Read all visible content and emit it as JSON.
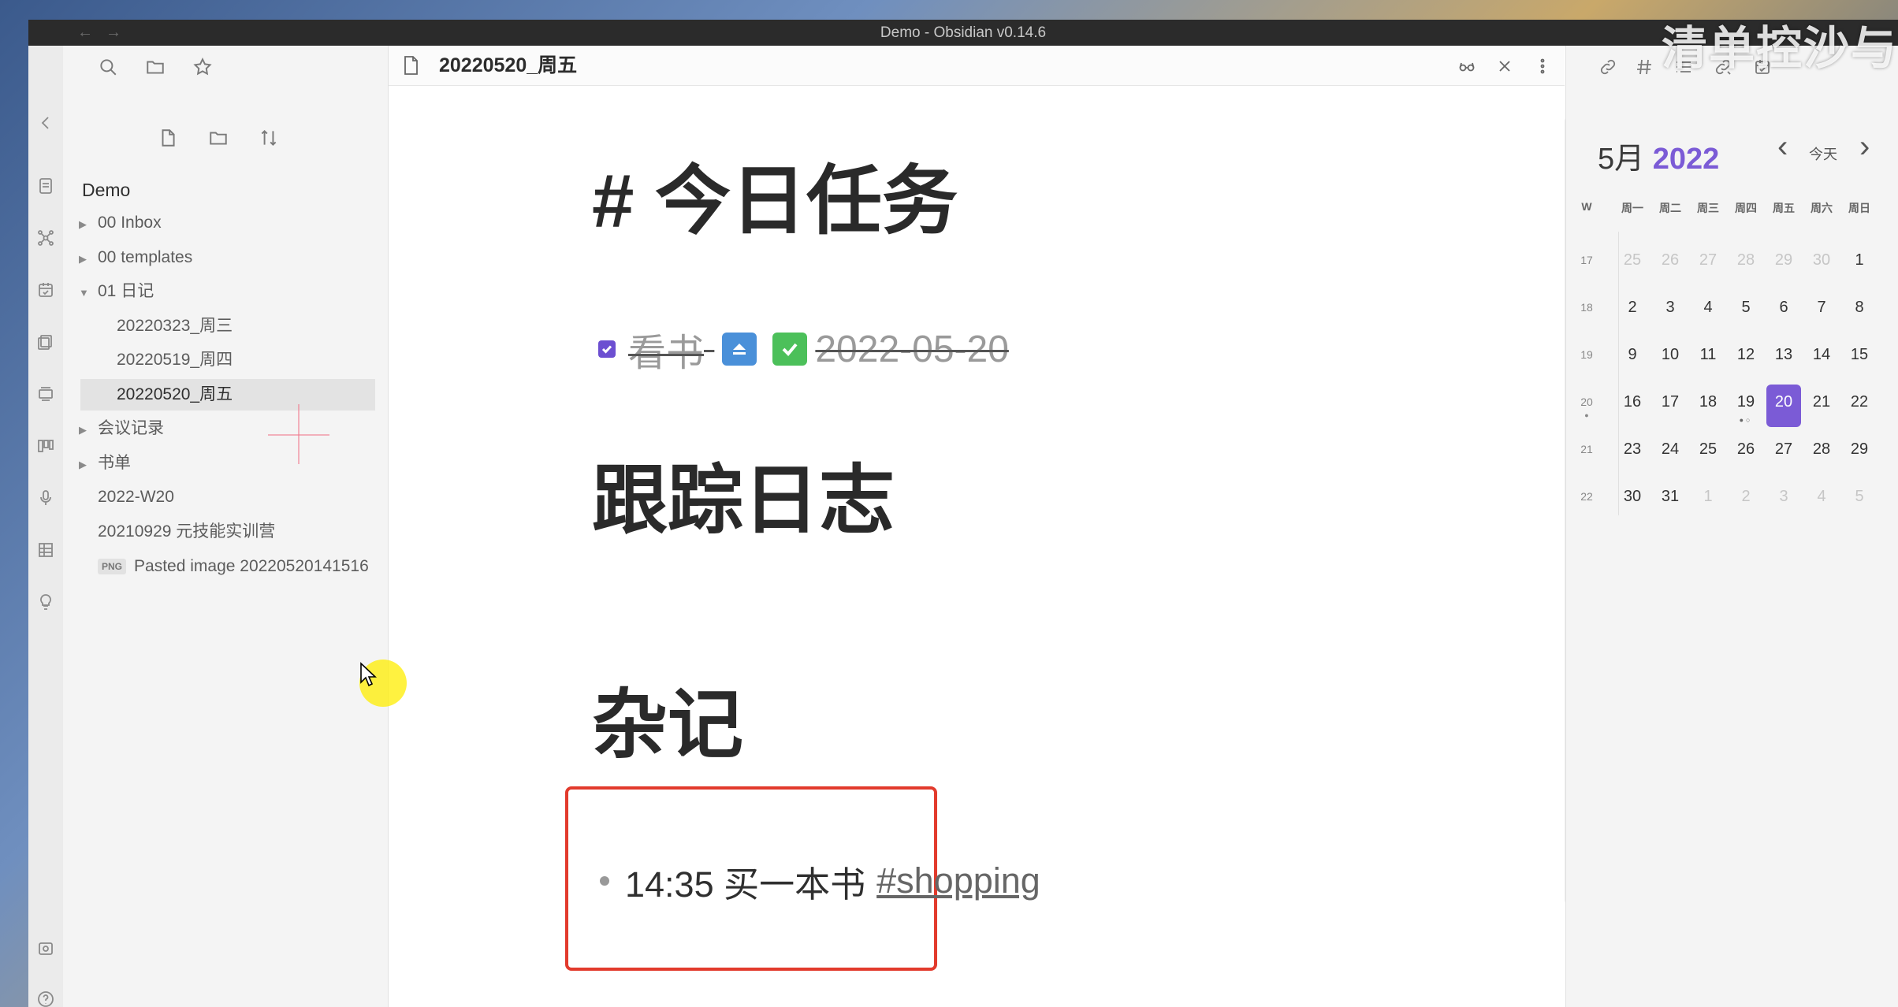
{
  "window": {
    "title": "Demo - Obsidian v0.14.6",
    "back": "←",
    "forward": "→"
  },
  "watermark": "清单控沙与",
  "sidebar": {
    "vault_name": "Demo",
    "tree": [
      {
        "label": "00 Inbox",
        "kind": "folder",
        "expanded": false
      },
      {
        "label": "00 templates",
        "kind": "folder",
        "expanded": false
      },
      {
        "label": "01 日记",
        "kind": "folder",
        "expanded": true
      },
      {
        "label": "20220323_周三",
        "kind": "file"
      },
      {
        "label": "20220519_周四",
        "kind": "file"
      },
      {
        "label": "20220520_周五",
        "kind": "file",
        "active": true
      },
      {
        "label": "会议记录",
        "kind": "folder",
        "expanded": false
      },
      {
        "label": "书单",
        "kind": "folder",
        "expanded": false
      },
      {
        "label": "2022-W20",
        "kind": "file"
      },
      {
        "label": "20210929 元技能实训营",
        "kind": "file"
      },
      {
        "label": "Pasted image 20220520141516",
        "kind": "png",
        "badge": "PNG"
      }
    ]
  },
  "editor": {
    "tab_title": "20220520_周五",
    "heading_tasks": "# 今日任务",
    "task_text": "看书",
    "task_date": "2022-05-20",
    "heading_log": "跟踪日志",
    "heading_notes": "杂记",
    "note_time_text": "14:35 买一本书",
    "note_tag": "#shopping"
  },
  "calendar": {
    "month": "5月",
    "year": "2022",
    "today_label": "今天",
    "prev": "‹",
    "next": "›",
    "week_header": "W",
    "day_headers": [
      "周一",
      "周二",
      "周三",
      "周四",
      "周五",
      "周六",
      "周日"
    ],
    "weeks": [
      {
        "w": "17",
        "days": [
          "25",
          "26",
          "27",
          "28",
          "29",
          "30",
          "1"
        ],
        "muted": [
          true,
          true,
          true,
          true,
          true,
          true,
          false
        ]
      },
      {
        "w": "18",
        "days": [
          "2",
          "3",
          "4",
          "5",
          "6",
          "7",
          "8"
        ],
        "muted": [
          false,
          false,
          false,
          false,
          false,
          false,
          false
        ]
      },
      {
        "w": "19",
        "days": [
          "9",
          "10",
          "11",
          "12",
          "13",
          "14",
          "15"
        ],
        "muted": [
          false,
          false,
          false,
          false,
          false,
          false,
          false
        ]
      },
      {
        "w": "20",
        "days": [
          "16",
          "17",
          "18",
          "19",
          "20",
          "21",
          "22"
        ],
        "muted": [
          false,
          false,
          false,
          false,
          false,
          false,
          false
        ]
      },
      {
        "w": "21",
        "days": [
          "23",
          "24",
          "25",
          "26",
          "27",
          "28",
          "29"
        ],
        "muted": [
          false,
          false,
          false,
          false,
          false,
          false,
          false
        ]
      },
      {
        "w": "22",
        "days": [
          "30",
          "31",
          "1",
          "2",
          "3",
          "4",
          "5"
        ],
        "muted": [
          false,
          false,
          true,
          true,
          true,
          true,
          true
        ]
      }
    ],
    "today": "20",
    "accent": "#7b5bd6"
  },
  "colors": {
    "highlight_border": "#e23a2c",
    "task_checkbox": "#6c4fd1",
    "priority_blue": "#4a90d9",
    "done_green": "#4cc05a"
  }
}
